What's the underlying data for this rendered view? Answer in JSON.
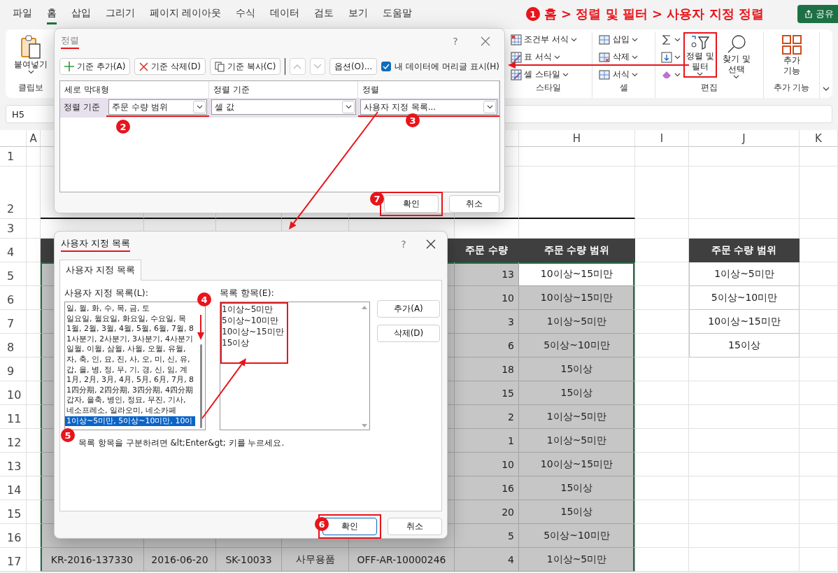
{
  "ribbon_tabs": [
    {
      "label": "파일",
      "selected": false
    },
    {
      "label": "홈",
      "selected": true
    },
    {
      "label": "삽입",
      "selected": false
    },
    {
      "label": "그리기",
      "selected": false
    },
    {
      "label": "페이지 레이아웃",
      "selected": false
    },
    {
      "label": "수식",
      "selected": false
    },
    {
      "label": "데이터",
      "selected": false
    },
    {
      "label": "검토",
      "selected": false
    },
    {
      "label": "보기",
      "selected": false
    },
    {
      "label": "도움말",
      "selected": false
    }
  ],
  "title_annotation": "홈 > 정렬 및 필터 > 사용자 지정 정렬",
  "step_badges": [
    "1",
    "2",
    "3",
    "4",
    "5",
    "6",
    "7"
  ],
  "share_button": "공유",
  "ribbon": {
    "clipboard": {
      "paste": "붙여넣기",
      "label": "클립보"
    },
    "styles": {
      "label": "스타일",
      "items": [
        "조건부 서식",
        "표 서식",
        "셀 스타일"
      ]
    },
    "cells": {
      "label": "셀",
      "items": [
        "삽입",
        "삭제",
        "서식"
      ]
    },
    "editing": {
      "label": "편집",
      "sort_filter": [
        "정렬 및",
        "필터"
      ],
      "find_select": [
        "찾기 및",
        "선택"
      ]
    },
    "addins": {
      "label": "추가 기능",
      "button": [
        "추가",
        "기능"
      ]
    }
  },
  "name_box": "H5",
  "sort_dialog": {
    "title": "정렬",
    "help": "?",
    "add": "기준 추가(A)",
    "delete": "기준 삭제(D)",
    "copy": "기준 복사(C)",
    "options": "옵션(O)...",
    "header_checkbox": {
      "label": "내 데이터에 머리글 표시(H)",
      "checked": true
    },
    "columns": [
      "세로 막대형",
      "정렬 기준",
      "정렬"
    ],
    "levels": [
      {
        "label": "정렬 기준",
        "column": "주문 수량 범위",
        "sort_on": "셀 값",
        "order": "사용자 지정 목록...",
        "selected": true
      }
    ],
    "buttons": [
      "확인",
      "취소"
    ]
  },
  "custom_lists_dialog": {
    "title": "사용자 지정 목록",
    "help": "?",
    "tabs": [
      {
        "label": "사용자 지정 목록",
        "selected": true
      }
    ],
    "lists_label": "사용자 지정 목록(L):",
    "lists": [
      {
        "text": "일, 월, 화, 수, 목, 금, 토",
        "selected": false
      },
      {
        "text": "일요일, 월요일, 화요일, 수요일, 목",
        "selected": false
      },
      {
        "text": "1월, 2월, 3월, 4월, 5월, 6월, 7월, 8",
        "selected": false
      },
      {
        "text": "1사분기, 2사분기, 3사분기, 4사분기",
        "selected": false
      },
      {
        "text": "일월, 이월, 삼월, 사월, 오월, 유월,",
        "selected": false
      },
      {
        "text": "자, 축, 인, 묘, 진, 사, 오, 미, 신, 유,",
        "selected": false
      },
      {
        "text": "갑, 을, 병, 정, 무, 기, 경, 신, 임, 계",
        "selected": false
      },
      {
        "text": "1月, 2月, 3月, 4月, 5月, 6月, 7月, 8",
        "selected": false
      },
      {
        "text": "1四分期, 2四分期, 3四分期, 4四分期",
        "selected": false
      },
      {
        "text": "갑자, 을축, 병인, 정묘, 무진, 기사,",
        "selected": false
      },
      {
        "text": "네소프레소, 일라오미, 네소카페",
        "selected": false
      },
      {
        "text": "1이상~5미만, 5이상~10미만, 10이",
        "selected": true
      }
    ],
    "entries_label": "목록 항목(E):",
    "entries": [
      "1이상~5미만",
      "5이상~10미만",
      "10이상~15미만",
      "15이상"
    ],
    "add": "추가(A)",
    "delete": "삭제(D)",
    "hint": "목록 항목을 구분하려면 &lt;Enter&gt; 키를 누르세요.",
    "buttons": [
      {
        "label": "확인",
        "focused": true
      },
      {
        "label": "취소",
        "focused": false
      }
    ]
  },
  "sheet": {
    "column_headers": [
      "A",
      "H",
      "I",
      "J",
      "K"
    ],
    "row_numbers": [
      "1",
      "2",
      "3",
      "4",
      "5",
      "6",
      "7",
      "8",
      "9",
      "10",
      "11",
      "12",
      "13",
      "14",
      "15",
      "16",
      "17"
    ],
    "order_table": {
      "headers": [
        "주문 수량",
        "주문 수량 범위"
      ],
      "rows": [
        {
          "qty": "13",
          "range": "10이상~15미만",
          "active": true
        },
        {
          "qty": "10",
          "range": "10이상~15미만",
          "active": false
        },
        {
          "qty": "3",
          "range": "1이상~5미만",
          "active": false
        },
        {
          "qty": "6",
          "range": "5이상~10미만",
          "active": false
        },
        {
          "qty": "18",
          "range": "15이상",
          "active": false
        },
        {
          "qty": "15",
          "range": "15이상",
          "active": false
        },
        {
          "qty": "2",
          "range": "1이상~5미만",
          "active": false
        },
        {
          "qty": "1",
          "range": "1이상~5미만",
          "active": false
        },
        {
          "qty": "10",
          "range": "10이상~15미만",
          "active": false
        },
        {
          "qty": "16",
          "range": "15이상",
          "active": false
        },
        {
          "qty": "20",
          "range": "15이상",
          "active": false
        },
        {
          "qty": "5",
          "range": "5이상~10미만",
          "active": false
        },
        {
          "qty": "4",
          "range": "1이상~5미만",
          "active": false
        }
      ]
    },
    "last_row_cells": [
      "KR-2016-137330",
      "2016-06-20",
      "SK-10033",
      "사무용품",
      "OFF-AR-10000246"
    ],
    "range_table": {
      "header": "주문 수량 범위",
      "rows": [
        "1이상~5미만",
        "5이상~10미만",
        "10이상~15미만",
        "15이상"
      ]
    }
  }
}
